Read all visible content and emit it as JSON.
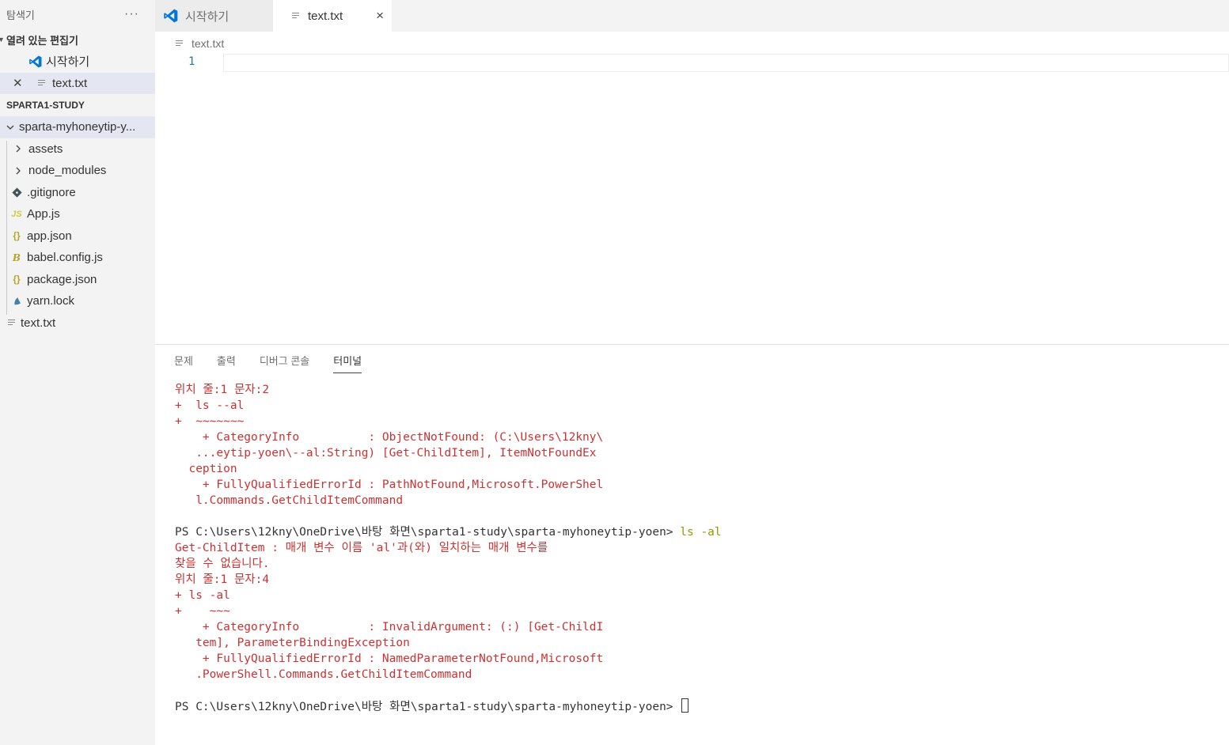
{
  "sidebar": {
    "title": "탐색기",
    "more": "···",
    "open_editors": {
      "title": "열려 있는 편집기",
      "items": [
        {
          "label": "시작하기"
        },
        {
          "label": "text.txt"
        }
      ]
    },
    "workspace": {
      "title": "SPARTA1-STUDY",
      "folder": "sparta-myhoneytip-y...",
      "items": [
        {
          "label": "assets",
          "icon": "chevron-right-icon"
        },
        {
          "label": "node_modules",
          "icon": "chevron-right-icon"
        },
        {
          "label": ".gitignore",
          "icon": "git-icon"
        },
        {
          "label": "App.js",
          "icon": "js-icon",
          "badge": "JS"
        },
        {
          "label": "app.json",
          "icon": "json-icon",
          "badge": "{}"
        },
        {
          "label": "babel.config.js",
          "icon": "babel-icon",
          "badge": "B"
        },
        {
          "label": "package.json",
          "icon": "json-icon",
          "badge": "{}"
        },
        {
          "label": "yarn.lock",
          "icon": "yarn-icon"
        }
      ],
      "root_file": "text.txt"
    }
  },
  "tabs": [
    {
      "label": "시작하기"
    },
    {
      "label": "text.txt",
      "close": "×"
    }
  ],
  "breadcrumb": "text.txt",
  "editor": {
    "line_number": "1"
  },
  "panel": {
    "tabs": [
      "문제",
      "출력",
      "디버그 콘솔",
      "터미널"
    ],
    "active_tab": "터미널"
  },
  "terminal": {
    "lines": [
      {
        "text": "위치 줄:1 문자:2",
        "style": "err"
      },
      {
        "text": "+  ls --al",
        "style": "err"
      },
      {
        "text": "+  ~~~~~~~",
        "style": "err"
      },
      {
        "text": "    + CategoryInfo          : ObjectNotFound: (C:\\Users\\12kny\\",
        "style": "err"
      },
      {
        "text": "   ...eytip-yoen\\--al:String) [Get-ChildItem], ItemNotFoundEx",
        "style": "err"
      },
      {
        "text": "  ception",
        "style": "err"
      },
      {
        "text": "    + FullyQualifiedErrorId : PathNotFound,Microsoft.PowerShel",
        "style": "err"
      },
      {
        "text": "   l.Commands.GetChildItemCommand",
        "style": "err"
      },
      {
        "text": "",
        "style": "normal"
      },
      {
        "text": "PS C:\\Users\\12kny\\OneDrive\\바탕 화면\\sparta1-study\\sparta-myhoneytip-yoen> ",
        "style": "normal",
        "cmd": "ls -al"
      },
      {
        "text": "Get-ChildItem : 매개 변수 이름 'al'과(와) 일치하는 매개 변수를",
        "style": "err"
      },
      {
        "text": "찾을 수 없습니다.",
        "style": "err"
      },
      {
        "text": "위치 줄:1 문자:4",
        "style": "err"
      },
      {
        "text": "+ ls -al",
        "style": "err"
      },
      {
        "text": "+    ~~~",
        "style": "err"
      },
      {
        "text": "    + CategoryInfo          : InvalidArgument: (:) [Get-ChildI",
        "style": "err"
      },
      {
        "text": "   tem], ParameterBindingException",
        "style": "err"
      },
      {
        "text": "    + FullyQualifiedErrorId : NamedParameterNotFound,Microsoft",
        "style": "err"
      },
      {
        "text": "   .PowerShell.Commands.GetChildItemCommand",
        "style": "err"
      },
      {
        "text": "",
        "style": "normal"
      },
      {
        "text": "PS C:\\Users\\12kny\\OneDrive\\바탕 화면\\sparta1-study\\sparta-myhoneytip-yoen> ",
        "style": "normal",
        "cursor": true
      }
    ]
  },
  "colors": {
    "error": "#cd3131",
    "command": "#949800",
    "vscode_blue": "#0078d4"
  }
}
